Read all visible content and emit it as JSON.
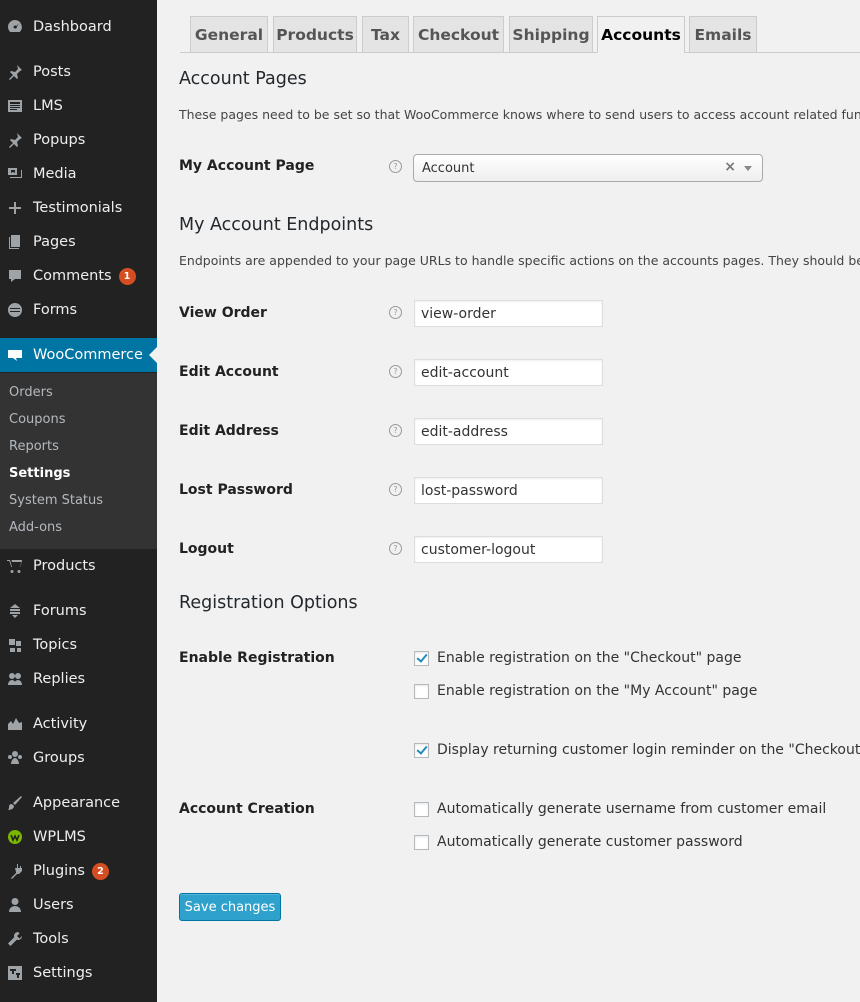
{
  "sidebar": {
    "items": [
      {
        "label": "Dashboard",
        "icon": "dashboard-icon"
      },
      {
        "label": "Posts",
        "icon": "pin-icon"
      },
      {
        "label": "LMS",
        "icon": "lms-icon"
      },
      {
        "label": "Popups",
        "icon": "pin-icon"
      },
      {
        "label": "Media",
        "icon": "media-icon"
      },
      {
        "label": "Testimonials",
        "icon": "plus-icon"
      },
      {
        "label": "Pages",
        "icon": "pages-icon"
      },
      {
        "label": "Comments",
        "icon": "comment-icon",
        "badge": "1"
      },
      {
        "label": "Forms",
        "icon": "forms-icon"
      },
      {
        "label": "WooCommerce",
        "icon": "woocommerce-icon",
        "active": true
      },
      {
        "label": "Products",
        "icon": "cart-icon"
      },
      {
        "label": "Forums",
        "icon": "forums-icon"
      },
      {
        "label": "Topics",
        "icon": "topics-icon"
      },
      {
        "label": "Replies",
        "icon": "replies-icon"
      },
      {
        "label": "Activity",
        "icon": "activity-icon"
      },
      {
        "label": "Groups",
        "icon": "groups-icon"
      },
      {
        "label": "Appearance",
        "icon": "brush-icon"
      },
      {
        "label": "WPLMS",
        "icon": "wplms-icon"
      },
      {
        "label": "Plugins",
        "icon": "plug-icon",
        "badge": "2"
      },
      {
        "label": "Users",
        "icon": "user-icon"
      },
      {
        "label": "Tools",
        "icon": "wrench-icon"
      },
      {
        "label": "Settings",
        "icon": "settings-icon"
      }
    ],
    "submenu": [
      "Orders",
      "Coupons",
      "Reports",
      "Settings",
      "System Status",
      "Add-ons"
    ],
    "submenu_current": "Settings"
  },
  "tabs": [
    {
      "label": "General"
    },
    {
      "label": "Products"
    },
    {
      "label": "Tax"
    },
    {
      "label": "Checkout"
    },
    {
      "label": "Shipping"
    },
    {
      "label": "Accounts",
      "active": true
    },
    {
      "label": "Emails"
    }
  ],
  "account_pages": {
    "heading": "Account Pages",
    "description": "These pages need to be set so that WooCommerce knows where to send users to access account related functiona",
    "my_account_label": "My Account Page",
    "my_account_value": "Account",
    "help": "?"
  },
  "endpoints": {
    "heading": "My Account Endpoints",
    "description": "Endpoints are appended to your page URLs to handle specific actions on the accounts pages. They should be uniqu",
    "fields": [
      {
        "label": "View Order",
        "value": "view-order"
      },
      {
        "label": "Edit Account",
        "value": "edit-account"
      },
      {
        "label": "Edit Address",
        "value": "edit-address"
      },
      {
        "label": "Lost Password",
        "value": "lost-password"
      },
      {
        "label": "Logout",
        "value": "customer-logout"
      }
    ]
  },
  "registration": {
    "heading": "Registration Options",
    "enable_label": "Enable Registration",
    "options": [
      {
        "label": "Enable registration on the \"Checkout\" page",
        "checked": true
      },
      {
        "label": "Enable registration on the \"My Account\" page",
        "checked": false
      },
      {
        "label": "Display returning customer login reminder on the \"Checkout\" p",
        "checked": true
      }
    ],
    "creation_label": "Account Creation",
    "creation_options": [
      {
        "label": "Automatically generate username from customer email",
        "checked": false
      },
      {
        "label": "Automatically generate customer password",
        "checked": false
      }
    ]
  },
  "save_label": "Save changes",
  "colors": {
    "accent": "#0074a2",
    "button": "#2ea2cc",
    "badge": "#d54e21",
    "sidebar": "#222222"
  }
}
